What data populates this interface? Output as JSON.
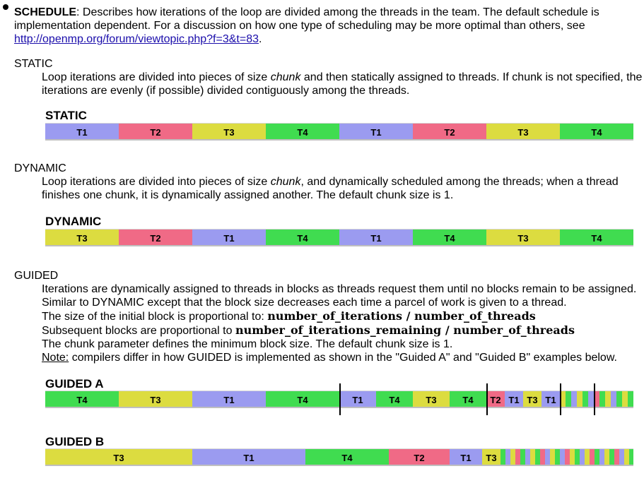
{
  "intro": {
    "term": "SCHEDULE",
    "text1": ": Describes how iterations of the loop are divided among the threads in the team. The default schedule is",
    "text2": "implementation dependent. For a discussion on how one type of scheduling may be more optimal than others, see",
    "link": "http://openmp.org/forum/viewtopic.php?f=3&t=83",
    "end": "."
  },
  "static": {
    "title": "STATIC",
    "l1a": "Loop iterations are divided into pieces of size ",
    "l1em": "chunk",
    "l1b": " and then statically assigned to threads. If chunk is not specified, the",
    "l2": "iterations are evenly (if possible) divided contiguously among the threads.",
    "heading": "STATIC"
  },
  "dynamic": {
    "title": "DYNAMIC",
    "l1a": "Loop iterations are divided into pieces of size ",
    "l1em": "chunk",
    "l1b": ", and dynamically scheduled among the threads; when a thread",
    "l2": "finishes one chunk, it is dynamically assigned another. The default chunk size is 1.",
    "heading": "DYNAMIC"
  },
  "guided": {
    "title": "GUIDED",
    "l1": "Iterations are dynamically assigned to threads in blocks as threads request them until no blocks remain to be assigned.",
    "l2": "Similar to DYNAMIC except that the block size decreases each time a parcel of work is given to a thread.",
    "l3a": "The size of the initial block is proportional to: ",
    "l3b": "number_of_iterations / number_of_threads",
    "l4a": "Subsequent blocks are proportional to ",
    "l4b": "number_of_iterations_remaining / number_of_threads",
    "l5": "The chunk parameter defines the minimum block size. The default chunk size is 1.",
    "note": "Note:",
    "l6": " compilers differ in how GUIDED is implemented as shown in the \"Guided A\" and \"Guided B\" examples below.",
    "headingA": "GUIDED A",
    "headingB": "GUIDED B"
  },
  "colors": {
    "T1": "#9b9bf0",
    "T2": "#f06a86",
    "T3": "#dcdc40",
    "T4": "#40dc50"
  },
  "bars": {
    "static": [
      [
        "T1",
        ""
      ],
      [
        "T2",
        ""
      ],
      [
        "T3",
        ""
      ],
      [
        "T4",
        ""
      ],
      [
        "T1",
        ""
      ],
      [
        "T2",
        ""
      ],
      [
        "T3",
        ""
      ],
      [
        "T4",
        ""
      ]
    ],
    "dynamic": [
      [
        "T3",
        ""
      ],
      [
        "T2",
        ""
      ],
      [
        "T1",
        ""
      ],
      [
        "T4",
        ""
      ],
      [
        "T1",
        ""
      ],
      [
        "T4",
        ""
      ],
      [
        "T3",
        ""
      ],
      [
        "T4",
        ""
      ]
    ],
    "labels": {
      "T1": "T1",
      "T2": "T2",
      "T3": "T3",
      "T4": "T4"
    }
  }
}
